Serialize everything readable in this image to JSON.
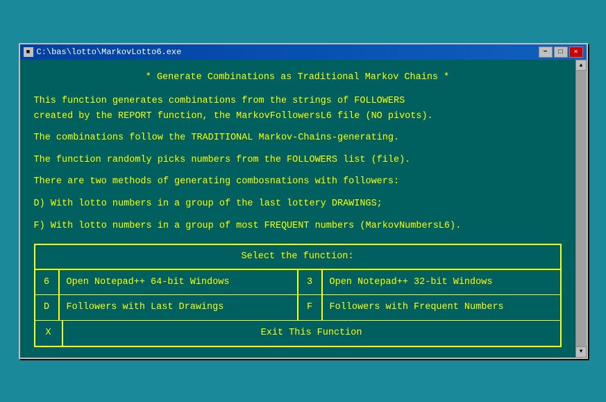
{
  "window": {
    "title": "C:\\bas\\lotto\\MarkovLotto6.exe",
    "minimize_label": "−",
    "maximize_label": "□",
    "close_label": "✕"
  },
  "content": {
    "title_line": "* Generate Combinations as Traditional Markov Chains *",
    "para1": "This function generates combinations from the strings of FOLLOWERS\ncreated by the REPORT function, the MarkovFollowersL6 file (NO pivots).",
    "para2": "The combinations follow the TRADITIONAL Markov-Chains-generating.",
    "para3": "The function randomly picks numbers from the FOLLOWERS list (file).",
    "para4": "There are two methods of generating combosnations with followers:",
    "para5a": "D) With lotto numbers in a group of the last lottery DRAWINGS;",
    "para5b": "F) With lotto numbers in a group of most FREQUENT numbers (MarkovNumbersL6).",
    "menu": {
      "header": "Select the function:",
      "row1": {
        "key1": "6",
        "label1": "Open Notepad++ 64-bit Windows",
        "key2": "3",
        "label2": "Open Notepad++ 32-bit Windows"
      },
      "row2": {
        "key1": "D",
        "label1": "Followers with Last Drawings",
        "key2": "F",
        "label2": "Followers with Frequent Numbers"
      },
      "row3": {
        "key": "X",
        "label": "Exit This Function"
      }
    }
  }
}
